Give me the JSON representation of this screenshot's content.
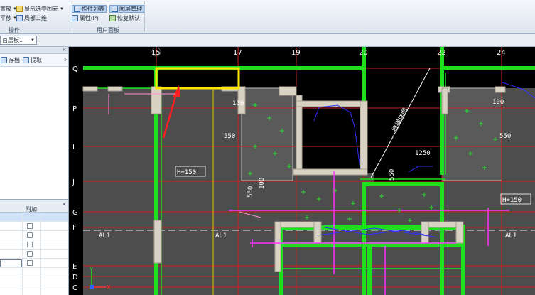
{
  "ribbon": {
    "rows": [
      {
        "label": "置放",
        "has_caret": true
      },
      {
        "label": "平移",
        "has_caret": true
      }
    ],
    "mid": [
      {
        "label": "显示选中图元",
        "has_caret": true
      },
      {
        "label": "局部三维"
      }
    ],
    "group_ops": "操作",
    "right": [
      {
        "label": "构件列表",
        "active": true
      },
      {
        "label": "属性(P)"
      },
      {
        "label": "图层管理",
        "active": true
      },
      {
        "label": "恢复默认"
      }
    ],
    "group_user": "用户面板"
  },
  "strip": {
    "floor_combo": "首层板1"
  },
  "panel1": {
    "save_label": "存档",
    "extract_label": "提取"
  },
  "panel2": {
    "column_header": "附加",
    "row_count": 7
  },
  "canvas": {
    "colors": {
      "background": "#000000",
      "wall_green": "#1fe01f",
      "highlight_yellow": "#ffe600",
      "arrow_red": "#ff2020",
      "magenta": "#ff33ff",
      "gray_fill": "#4b4b4b"
    },
    "axis_numbers": [
      "15",
      "17",
      "19",
      "20",
      "22",
      "24"
    ],
    "axis_letters": [
      "Q",
      "P",
      "L",
      "J",
      "G",
      "F",
      "E",
      "D",
      "C"
    ],
    "dims": {
      "d100_a": "100",
      "d550_a": "550",
      "h150_a": "H=150",
      "d550_v": "550",
      "d100_v": "100",
      "d1250": "1250",
      "d550_v2": "550",
      "d100_b": "100",
      "d550_b": "550",
      "h150_b": "H=150",
      "al1_a": "AL1",
      "al1_b": "AL1",
      "al1_c": "AL1"
    },
    "ramp_label": "楼梯详图",
    "ucs_x": "X",
    "ucs_y": "Y"
  }
}
